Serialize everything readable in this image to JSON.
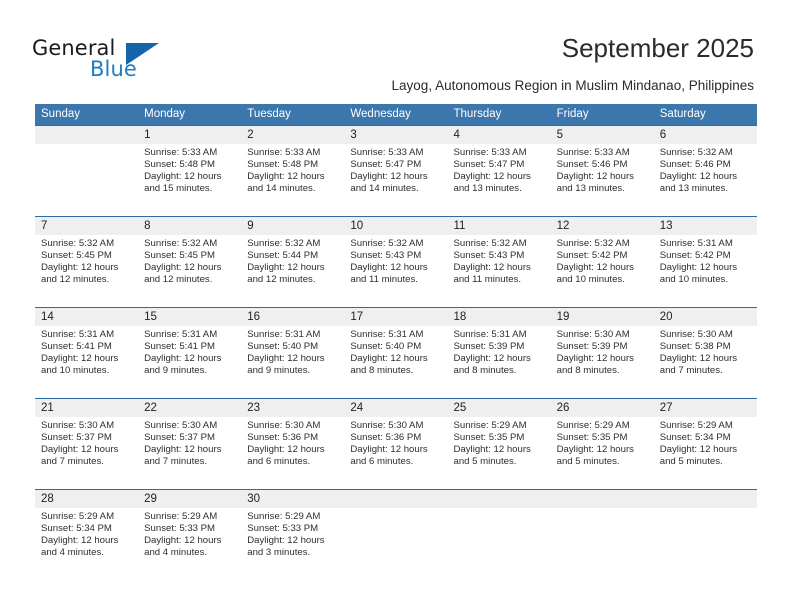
{
  "brand": {
    "name_part1": "General",
    "name_part2": "Blue",
    "triangle_color": "#1565a8",
    "blue_color": "#1d7dc4"
  },
  "header": {
    "title": "September 2025",
    "subtitle": "Layog, Autonomous Region in Muslim Mindanao, Philippines"
  },
  "theme": {
    "header_row_bg": "#3b76ad",
    "header_row_text": "#ffffff",
    "day_number_bg": "#efefef",
    "week_divider": "#2e6ca4"
  },
  "calendar": {
    "day_names": [
      "Sunday",
      "Monday",
      "Tuesday",
      "Wednesday",
      "Thursday",
      "Friday",
      "Saturday"
    ],
    "weeks": [
      {
        "days": [
          {
            "num": "",
            "sunrise": "",
            "sunset": "",
            "daylight1": "",
            "daylight2": ""
          },
          {
            "num": "1",
            "sunrise": "Sunrise: 5:33 AM",
            "sunset": "Sunset: 5:48 PM",
            "daylight1": "Daylight: 12 hours",
            "daylight2": "and 15 minutes."
          },
          {
            "num": "2",
            "sunrise": "Sunrise: 5:33 AM",
            "sunset": "Sunset: 5:48 PM",
            "daylight1": "Daylight: 12 hours",
            "daylight2": "and 14 minutes."
          },
          {
            "num": "3",
            "sunrise": "Sunrise: 5:33 AM",
            "sunset": "Sunset: 5:47 PM",
            "daylight1": "Daylight: 12 hours",
            "daylight2": "and 14 minutes."
          },
          {
            "num": "4",
            "sunrise": "Sunrise: 5:33 AM",
            "sunset": "Sunset: 5:47 PM",
            "daylight1": "Daylight: 12 hours",
            "daylight2": "and 13 minutes."
          },
          {
            "num": "5",
            "sunrise": "Sunrise: 5:33 AM",
            "sunset": "Sunset: 5:46 PM",
            "daylight1": "Daylight: 12 hours",
            "daylight2": "and 13 minutes."
          },
          {
            "num": "6",
            "sunrise": "Sunrise: 5:32 AM",
            "sunset": "Sunset: 5:46 PM",
            "daylight1": "Daylight: 12 hours",
            "daylight2": "and 13 minutes."
          }
        ]
      },
      {
        "days": [
          {
            "num": "7",
            "sunrise": "Sunrise: 5:32 AM",
            "sunset": "Sunset: 5:45 PM",
            "daylight1": "Daylight: 12 hours",
            "daylight2": "and 12 minutes."
          },
          {
            "num": "8",
            "sunrise": "Sunrise: 5:32 AM",
            "sunset": "Sunset: 5:45 PM",
            "daylight1": "Daylight: 12 hours",
            "daylight2": "and 12 minutes."
          },
          {
            "num": "9",
            "sunrise": "Sunrise: 5:32 AM",
            "sunset": "Sunset: 5:44 PM",
            "daylight1": "Daylight: 12 hours",
            "daylight2": "and 12 minutes."
          },
          {
            "num": "10",
            "sunrise": "Sunrise: 5:32 AM",
            "sunset": "Sunset: 5:43 PM",
            "daylight1": "Daylight: 12 hours",
            "daylight2": "and 11 minutes."
          },
          {
            "num": "11",
            "sunrise": "Sunrise: 5:32 AM",
            "sunset": "Sunset: 5:43 PM",
            "daylight1": "Daylight: 12 hours",
            "daylight2": "and 11 minutes."
          },
          {
            "num": "12",
            "sunrise": "Sunrise: 5:32 AM",
            "sunset": "Sunset: 5:42 PM",
            "daylight1": "Daylight: 12 hours",
            "daylight2": "and 10 minutes."
          },
          {
            "num": "13",
            "sunrise": "Sunrise: 5:31 AM",
            "sunset": "Sunset: 5:42 PM",
            "daylight1": "Daylight: 12 hours",
            "daylight2": "and 10 minutes."
          }
        ]
      },
      {
        "days": [
          {
            "num": "14",
            "sunrise": "Sunrise: 5:31 AM",
            "sunset": "Sunset: 5:41 PM",
            "daylight1": "Daylight: 12 hours",
            "daylight2": "and 10 minutes."
          },
          {
            "num": "15",
            "sunrise": "Sunrise: 5:31 AM",
            "sunset": "Sunset: 5:41 PM",
            "daylight1": "Daylight: 12 hours",
            "daylight2": "and 9 minutes."
          },
          {
            "num": "16",
            "sunrise": "Sunrise: 5:31 AM",
            "sunset": "Sunset: 5:40 PM",
            "daylight1": "Daylight: 12 hours",
            "daylight2": "and 9 minutes."
          },
          {
            "num": "17",
            "sunrise": "Sunrise: 5:31 AM",
            "sunset": "Sunset: 5:40 PM",
            "daylight1": "Daylight: 12 hours",
            "daylight2": "and 8 minutes."
          },
          {
            "num": "18",
            "sunrise": "Sunrise: 5:31 AM",
            "sunset": "Sunset: 5:39 PM",
            "daylight1": "Daylight: 12 hours",
            "daylight2": "and 8 minutes."
          },
          {
            "num": "19",
            "sunrise": "Sunrise: 5:30 AM",
            "sunset": "Sunset: 5:39 PM",
            "daylight1": "Daylight: 12 hours",
            "daylight2": "and 8 minutes."
          },
          {
            "num": "20",
            "sunrise": "Sunrise: 5:30 AM",
            "sunset": "Sunset: 5:38 PM",
            "daylight1": "Daylight: 12 hours",
            "daylight2": "and 7 minutes."
          }
        ]
      },
      {
        "days": [
          {
            "num": "21",
            "sunrise": "Sunrise: 5:30 AM",
            "sunset": "Sunset: 5:37 PM",
            "daylight1": "Daylight: 12 hours",
            "daylight2": "and 7 minutes."
          },
          {
            "num": "22",
            "sunrise": "Sunrise: 5:30 AM",
            "sunset": "Sunset: 5:37 PM",
            "daylight1": "Daylight: 12 hours",
            "daylight2": "and 7 minutes."
          },
          {
            "num": "23",
            "sunrise": "Sunrise: 5:30 AM",
            "sunset": "Sunset: 5:36 PM",
            "daylight1": "Daylight: 12 hours",
            "daylight2": "and 6 minutes."
          },
          {
            "num": "24",
            "sunrise": "Sunrise: 5:30 AM",
            "sunset": "Sunset: 5:36 PM",
            "daylight1": "Daylight: 12 hours",
            "daylight2": "and 6 minutes."
          },
          {
            "num": "25",
            "sunrise": "Sunrise: 5:29 AM",
            "sunset": "Sunset: 5:35 PM",
            "daylight1": "Daylight: 12 hours",
            "daylight2": "and 5 minutes."
          },
          {
            "num": "26",
            "sunrise": "Sunrise: 5:29 AM",
            "sunset": "Sunset: 5:35 PM",
            "daylight1": "Daylight: 12 hours",
            "daylight2": "and 5 minutes."
          },
          {
            "num": "27",
            "sunrise": "Sunrise: 5:29 AM",
            "sunset": "Sunset: 5:34 PM",
            "daylight1": "Daylight: 12 hours",
            "daylight2": "and 5 minutes."
          }
        ]
      },
      {
        "days": [
          {
            "num": "28",
            "sunrise": "Sunrise: 5:29 AM",
            "sunset": "Sunset: 5:34 PM",
            "daylight1": "Daylight: 12 hours",
            "daylight2": "and 4 minutes."
          },
          {
            "num": "29",
            "sunrise": "Sunrise: 5:29 AM",
            "sunset": "Sunset: 5:33 PM",
            "daylight1": "Daylight: 12 hours",
            "daylight2": "and 4 minutes."
          },
          {
            "num": "30",
            "sunrise": "Sunrise: 5:29 AM",
            "sunset": "Sunset: 5:33 PM",
            "daylight1": "Daylight: 12 hours",
            "daylight2": "and 3 minutes."
          },
          {
            "num": "",
            "sunrise": "",
            "sunset": "",
            "daylight1": "",
            "daylight2": ""
          },
          {
            "num": "",
            "sunrise": "",
            "sunset": "",
            "daylight1": "",
            "daylight2": ""
          },
          {
            "num": "",
            "sunrise": "",
            "sunset": "",
            "daylight1": "",
            "daylight2": ""
          },
          {
            "num": "",
            "sunrise": "",
            "sunset": "",
            "daylight1": "",
            "daylight2": ""
          }
        ]
      }
    ]
  }
}
